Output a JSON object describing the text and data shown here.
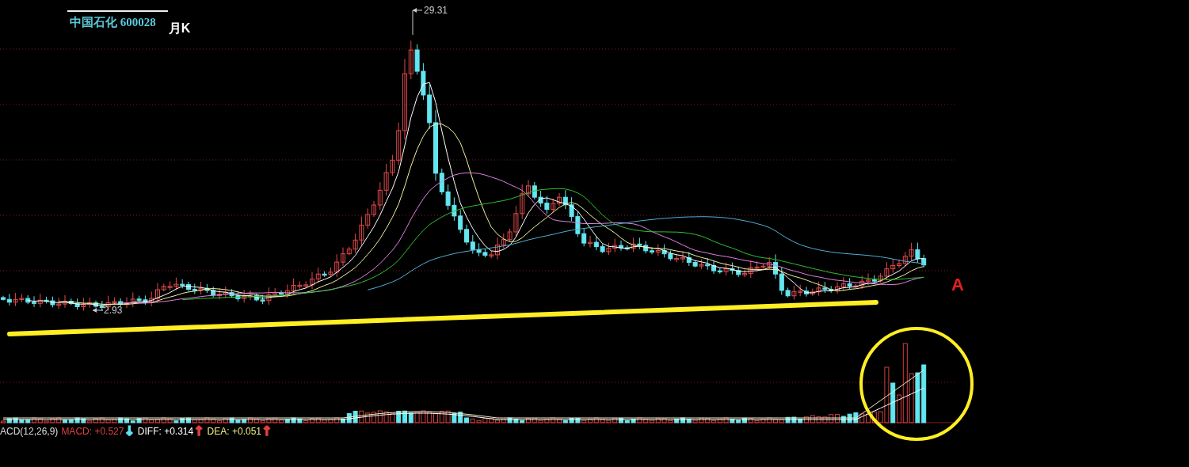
{
  "header": {
    "stock_name": "中国石化",
    "stock_code": "600028",
    "period": "月K"
  },
  "chart": {
    "high_label": "29.31",
    "low_label": "2.93",
    "marker": "A"
  },
  "indicator": {
    "name": "ACD(12,26,9)",
    "values": [
      {
        "kind": "value",
        "text": "MACD: +0.527",
        "color": "#e04040"
      },
      {
        "kind": "arrow",
        "text": "↓",
        "color": "#60e0f0"
      },
      {
        "kind": "value",
        "text": "DIFF: +0.314",
        "color": "#ffffff"
      },
      {
        "kind": "arrow",
        "text": "↑",
        "color": "#e04040"
      },
      {
        "kind": "value",
        "text": "DEA: +0.051",
        "color": "#f0f080"
      },
      {
        "kind": "arrow",
        "text": "↑",
        "color": "#e04040"
      }
    ]
  }
}
